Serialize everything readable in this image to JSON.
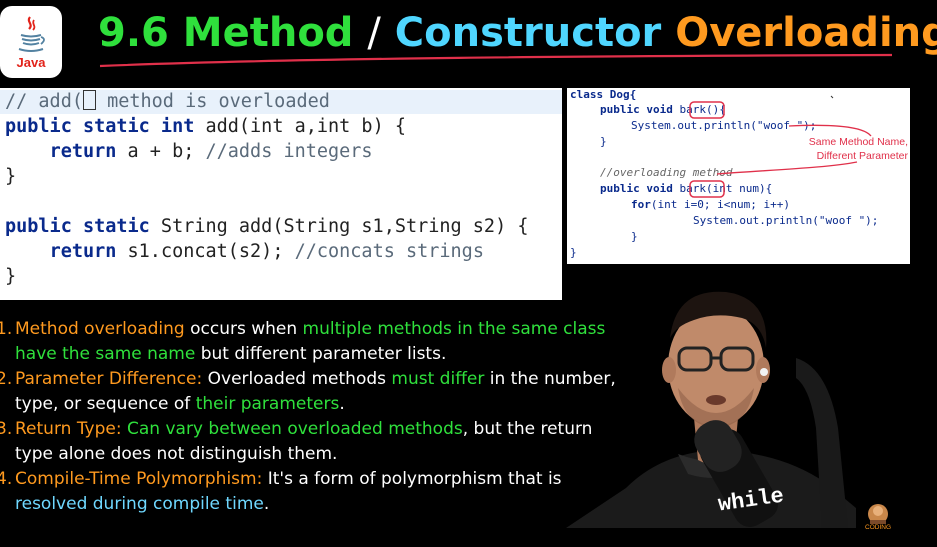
{
  "logo": {
    "text": "Java"
  },
  "title": {
    "part1": "9.6 Method",
    "sep": "/",
    "part2": "Constructor",
    "part3": "Overloading"
  },
  "code_left": {
    "l1_pre": "// add(",
    "l1_post": " method is overloaded",
    "l2_kw": "public static int",
    "l2_rest": " add(int a,int b) {",
    "l3_kw": "return",
    "l3_rest": " a + b; ",
    "l3_cm": "//adds integers",
    "l4": "}",
    "l6_kw": "public static",
    "l6_rest": " String add(String s1,String s2) {",
    "l7_kw": "return",
    "l7_rest": " s1.concat(s2); ",
    "l7_cm": "//concats strings",
    "l8": "}"
  },
  "code_right": {
    "r1": "class Dog{",
    "r2_kw": "public void",
    "r2_fn": "bark",
    "r2_rest": "(){",
    "r3": "System.out.println(\"woof \");",
    "r4": "}",
    "r5": "//overloading method",
    "r6_kw": "public void",
    "r6_fn": "bark",
    "r6_rest": "(int num){",
    "r7_kw": "for",
    "r7_rest": "(int i=0; i<num; i++)",
    "r8": "System.out.println(\"woof \");",
    "r9": "}",
    "r10": "}",
    "note1": "Same Method Name,",
    "note2": "Different Parameter"
  },
  "points": [
    {
      "num": "1.",
      "a": "Method overloading",
      "b": " occurs when ",
      "c": "multiple methods in the same class",
      "d": "have the same name",
      "e": " but different parameter lists."
    },
    {
      "num": "2.",
      "a": "Parameter Difference:",
      "b": " Overloaded methods ",
      "c": "must differ",
      "d": " in the number,",
      "e": "type, or sequence of ",
      "f": "their parameters",
      "g": "."
    },
    {
      "num": "3.",
      "a": "Return Type:",
      "b": " ",
      "c": "Can vary between overloaded methods",
      "d": ", but the return",
      "e": "type alone does not distinguish them."
    },
    {
      "num": "4.",
      "a": "Compile-Time Polymorphism:",
      "b": " It's a form of polymorphism that is",
      "c": "resolved during compile time",
      "d": "."
    }
  ],
  "presenter": {
    "shirt_text": "while"
  },
  "brand": {
    "text": "CODING"
  },
  "colors": {
    "green": "#2fe03c",
    "cyan": "#4fd6ff",
    "orange": "#ff9a1f",
    "java_red": "#e2231a",
    "annotation_red": "#e0304a"
  }
}
